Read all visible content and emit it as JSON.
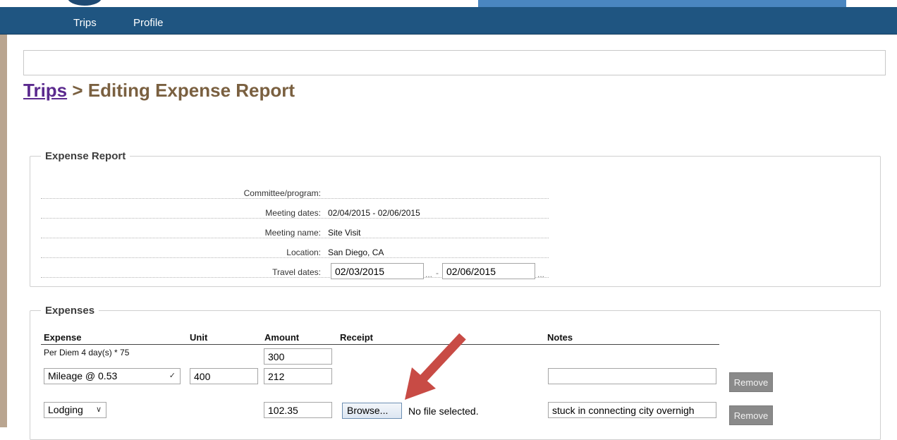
{
  "nav": {
    "items": [
      "Trips",
      "Profile"
    ]
  },
  "breadcrumb": {
    "link": "Trips",
    "rest": " > Editing Expense Report"
  },
  "expense_report": {
    "legend": "Expense Report",
    "rows": [
      {
        "label": "Committee/program:",
        "value": ""
      },
      {
        "label": "Meeting dates:",
        "value": "02/04/2015 - 02/06/2015"
      },
      {
        "label": "Meeting name:",
        "value": "Site Visit"
      },
      {
        "label": "Location:",
        "value": "San Diego, CA"
      },
      {
        "label": "Travel dates:"
      }
    ],
    "travel_start": "02/03/2015",
    "travel_end": "02/06/2015",
    "picker": "...",
    "range_sep": "-"
  },
  "expenses": {
    "legend": "Expenses",
    "headers": [
      "Expense",
      "Unit",
      "Amount",
      "Receipt",
      "Notes"
    ],
    "per_diem": {
      "label": "Per Diem 4 day(s) * 75",
      "amount": "300"
    },
    "mileage": {
      "type": "Mileage @ 0.53",
      "unit": "400",
      "amount": "212",
      "notes": "",
      "remove": "Remove"
    },
    "lodging": {
      "type": "Lodging",
      "amount": "102.35",
      "browse": "Browse...",
      "file_status": "No file selected.",
      "notes": "stuck in connecting city overnigh",
      "remove": "Remove"
    }
  },
  "colors": {
    "nav_bg": "#1f5581",
    "title": "#7a6040",
    "link": "#5b2a8e",
    "arrow": "#c84b45"
  }
}
